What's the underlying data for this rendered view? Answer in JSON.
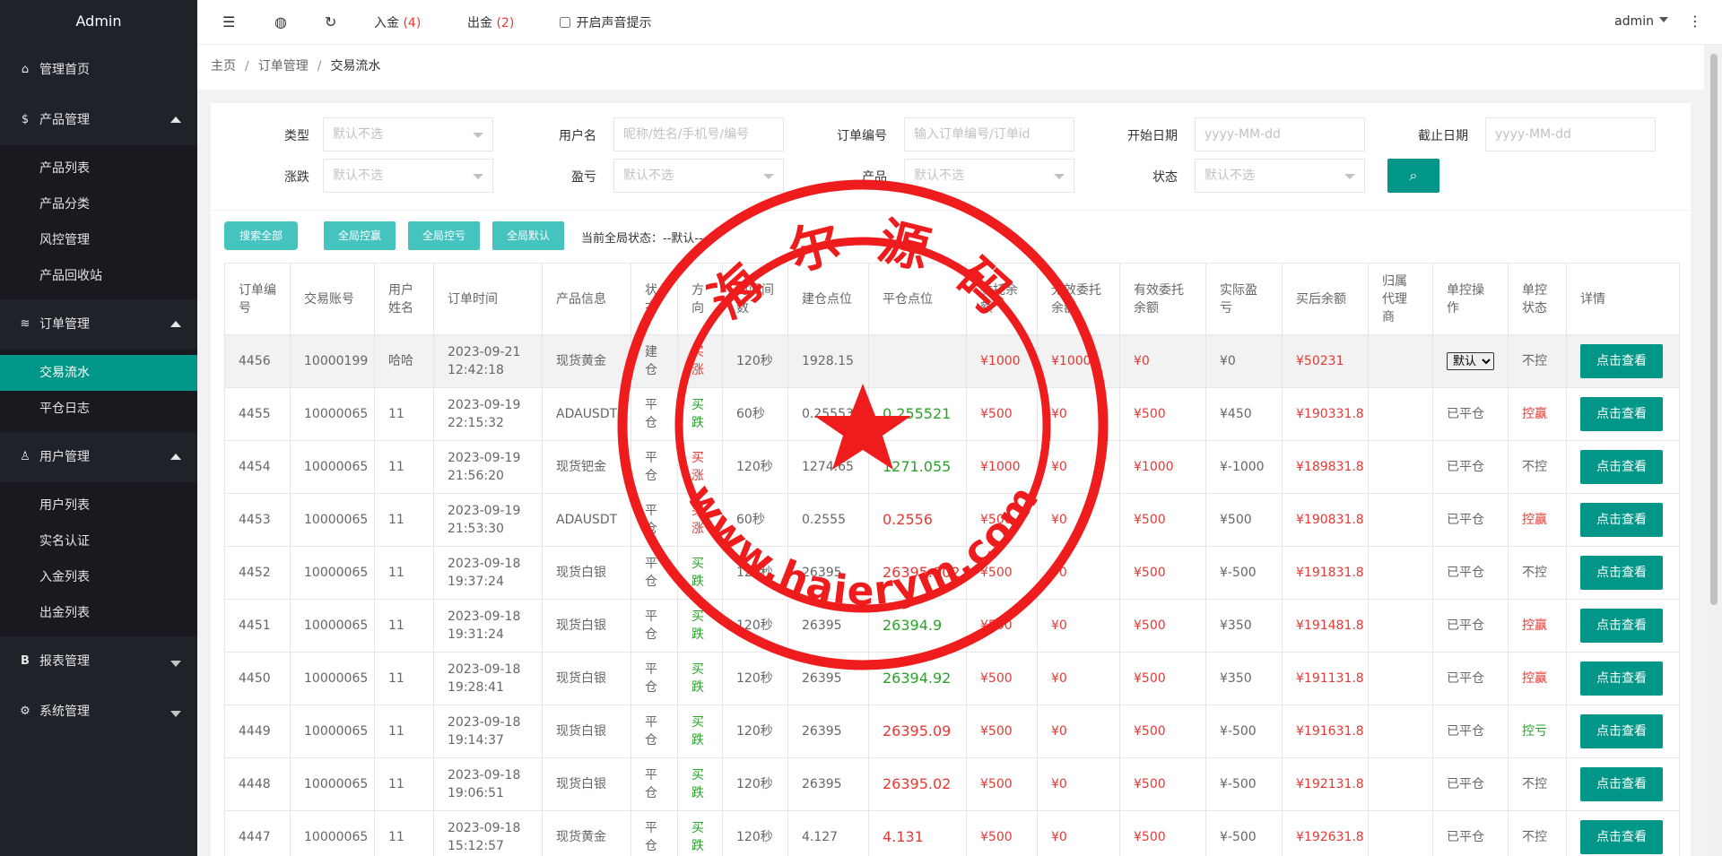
{
  "app": {
    "title": "Admin"
  },
  "sidebar": {
    "groups": [
      {
        "label": "管理首页",
        "icon": "home-icon"
      },
      {
        "label": "产品管理",
        "icon": "dollar-circle-icon",
        "items": [
          "产品列表",
          "产品分类",
          "风控管理",
          "产品回收站"
        ]
      },
      {
        "label": "订单管理",
        "icon": "layers-icon",
        "items": [
          "交易流水",
          "平仓日志"
        ]
      },
      {
        "label": "用户管理",
        "icon": "user-icon",
        "items": [
          "用户列表",
          "实名认证",
          "入金列表",
          "出金列表"
        ]
      },
      {
        "label": "报表管理",
        "icon": "bold-b-icon"
      },
      {
        "label": "系统管理",
        "icon": "gear-icon"
      }
    ],
    "active_item": "交易流水"
  },
  "header": {
    "deposit_label": "入金",
    "deposit_count": "(4)",
    "withdraw_label": "出金",
    "withdraw_count": "(2)",
    "sound_label": "开启声音提示",
    "user": "admin"
  },
  "breadcrumb": [
    "主页",
    "订单管理",
    "交易流水"
  ],
  "filters": {
    "type_label": "类型",
    "type_placeholder": "默认不选",
    "username_label": "用户名",
    "username_placeholder": "昵称/姓名/手机号/编号",
    "order_label": "订单编号",
    "order_placeholder": "输入订单编号/订单id",
    "start_label": "开始日期",
    "start_placeholder": "yyyy-MM-dd",
    "end_label": "截止日期",
    "end_placeholder": "yyyy-MM-dd",
    "updown_label": "涨跌",
    "updown_placeholder": "默认不选",
    "pnl_label": "盈亏",
    "pnl_placeholder": "默认不选",
    "product_label": "产品",
    "product_placeholder": "默认不选",
    "status_label": "状态",
    "status_placeholder": "默认不选"
  },
  "toolbar": {
    "search_all": "搜索全部",
    "global_win": "全局控赢",
    "global_lose": "全局控亏",
    "global_default": "全局默认",
    "global_status": "当前全局状态：--默认--"
  },
  "table": {
    "headers": [
      "订单编号",
      "交易账号",
      "用户姓名",
      "订单时间",
      "产品信息",
      "状态",
      "方向",
      "时间间数",
      "建仓点位",
      "平仓点位",
      "委托余额",
      "无效委托余额",
      "有效委托余额",
      "实际盈亏",
      "买后余额",
      "归属代理商",
      "单控操作",
      "单控状态",
      "详情"
    ],
    "view_label": "点击查看",
    "select_default": "默认",
    "rows": [
      {
        "id": "4456",
        "account": "10000199",
        "name": "哈哈",
        "date": "2023-09-21",
        "time": "12:42:18",
        "product": "现货黄金",
        "state": "建仓",
        "dir": "买涨",
        "period": "120秒",
        "open": "1928.15",
        "close": "",
        "close_color": "red",
        "entrust": "¥1000",
        "invalid": "¥1000",
        "valid": "¥0",
        "pnl": "¥0",
        "after": "¥50231",
        "agent": "",
        "op": "select",
        "ctl": "不控",
        "ctl_color": "gray"
      },
      {
        "id": "4455",
        "account": "10000065",
        "name": "11",
        "date": "2023-09-19",
        "time": "22:15:32",
        "product": "ADAUSDT",
        "state": "平仓",
        "dir": "买跌",
        "period": "60秒",
        "open": "0.255533",
        "close": "0.255521",
        "close_color": "green",
        "entrust": "¥500",
        "invalid": "¥0",
        "valid": "¥500",
        "pnl": "¥450",
        "after": "¥190331.8",
        "agent": "",
        "op": "已平仓",
        "ctl": "控赢",
        "ctl_color": "red"
      },
      {
        "id": "4454",
        "account": "10000065",
        "name": "11",
        "date": "2023-09-19",
        "time": "21:56:20",
        "product": "现货钯金",
        "state": "平仓",
        "dir": "买涨",
        "period": "120秒",
        "open": "1274.65",
        "close": "1271.055",
        "close_color": "green",
        "entrust": "¥1000",
        "invalid": "¥0",
        "valid": "¥1000",
        "pnl": "¥-1000",
        "after": "¥189831.8",
        "agent": "",
        "op": "已平仓",
        "ctl": "不控",
        "ctl_color": "gray"
      },
      {
        "id": "4453",
        "account": "10000065",
        "name": "11",
        "date": "2023-09-19",
        "time": "21:53:30",
        "product": "ADAUSDT",
        "state": "平仓",
        "dir": "买涨",
        "period": "60秒",
        "open": "0.2555",
        "close": "0.2556",
        "close_color": "red",
        "entrust": "¥500",
        "invalid": "¥0",
        "valid": "¥500",
        "pnl": "¥500",
        "after": "¥190831.8",
        "agent": "",
        "op": "已平仓",
        "ctl": "控赢",
        "ctl_color": "red"
      },
      {
        "id": "4452",
        "account": "10000065",
        "name": "11",
        "date": "2023-09-18",
        "time": "19:37:24",
        "product": "现货白银",
        "state": "平仓",
        "dir": "买跌",
        "period": "120秒",
        "open": "26395",
        "close": "26395.002",
        "close_color": "red",
        "entrust": "¥500",
        "invalid": "¥0",
        "valid": "¥500",
        "pnl": "¥-500",
        "after": "¥191831.8",
        "agent": "",
        "op": "已平仓",
        "ctl": "不控",
        "ctl_color": "gray"
      },
      {
        "id": "4451",
        "account": "10000065",
        "name": "11",
        "date": "2023-09-18",
        "time": "19:31:24",
        "product": "现货白银",
        "state": "平仓",
        "dir": "买跌",
        "period": "120秒",
        "open": "26395",
        "close": "26394.9",
        "close_color": "green",
        "entrust": "¥500",
        "invalid": "¥0",
        "valid": "¥500",
        "pnl": "¥350",
        "after": "¥191481.8",
        "agent": "",
        "op": "已平仓",
        "ctl": "控赢",
        "ctl_color": "red"
      },
      {
        "id": "4450",
        "account": "10000065",
        "name": "11",
        "date": "2023-09-18",
        "time": "19:28:41",
        "product": "现货白银",
        "state": "平仓",
        "dir": "买跌",
        "period": "120秒",
        "open": "26395",
        "close": "26394.92",
        "close_color": "green",
        "entrust": "¥500",
        "invalid": "¥0",
        "valid": "¥500",
        "pnl": "¥350",
        "after": "¥191131.8",
        "agent": "",
        "op": "已平仓",
        "ctl": "控赢",
        "ctl_color": "red"
      },
      {
        "id": "4449",
        "account": "10000065",
        "name": "11",
        "date": "2023-09-18",
        "time": "19:14:37",
        "product": "现货白银",
        "state": "平仓",
        "dir": "买跌",
        "period": "120秒",
        "open": "26395",
        "close": "26395.09",
        "close_color": "red",
        "entrust": "¥500",
        "invalid": "¥0",
        "valid": "¥500",
        "pnl": "¥-500",
        "after": "¥191631.8",
        "agent": "",
        "op": "已平仓",
        "ctl": "控亏",
        "ctl_color": "green"
      },
      {
        "id": "4448",
        "account": "10000065",
        "name": "11",
        "date": "2023-09-18",
        "time": "19:06:51",
        "product": "现货白银",
        "state": "平仓",
        "dir": "买跌",
        "period": "120秒",
        "open": "26395",
        "close": "26395.02",
        "close_color": "red",
        "entrust": "¥500",
        "invalid": "¥0",
        "valid": "¥500",
        "pnl": "¥-500",
        "after": "¥192131.8",
        "agent": "",
        "op": "已平仓",
        "ctl": "不控",
        "ctl_color": "gray"
      },
      {
        "id": "4447",
        "account": "10000065",
        "name": "11",
        "date": "2023-09-18",
        "time": "15:12:57",
        "product": "现货黄金",
        "state": "平仓",
        "dir": "买跌",
        "period": "120秒",
        "open": "4.127",
        "close": "4.131",
        "close_color": "red",
        "entrust": "¥500",
        "invalid": "¥0",
        "valid": "¥500",
        "pnl": "¥-500",
        "after": "¥192631.8",
        "agent": "",
        "op": "已平仓",
        "ctl": "不控",
        "ctl_color": "gray"
      }
    ]
  },
  "stamp": {
    "top_text": "海 尔 源 码",
    "bottom_text": "www.haierym.com",
    "color": "#ee1c1c"
  }
}
